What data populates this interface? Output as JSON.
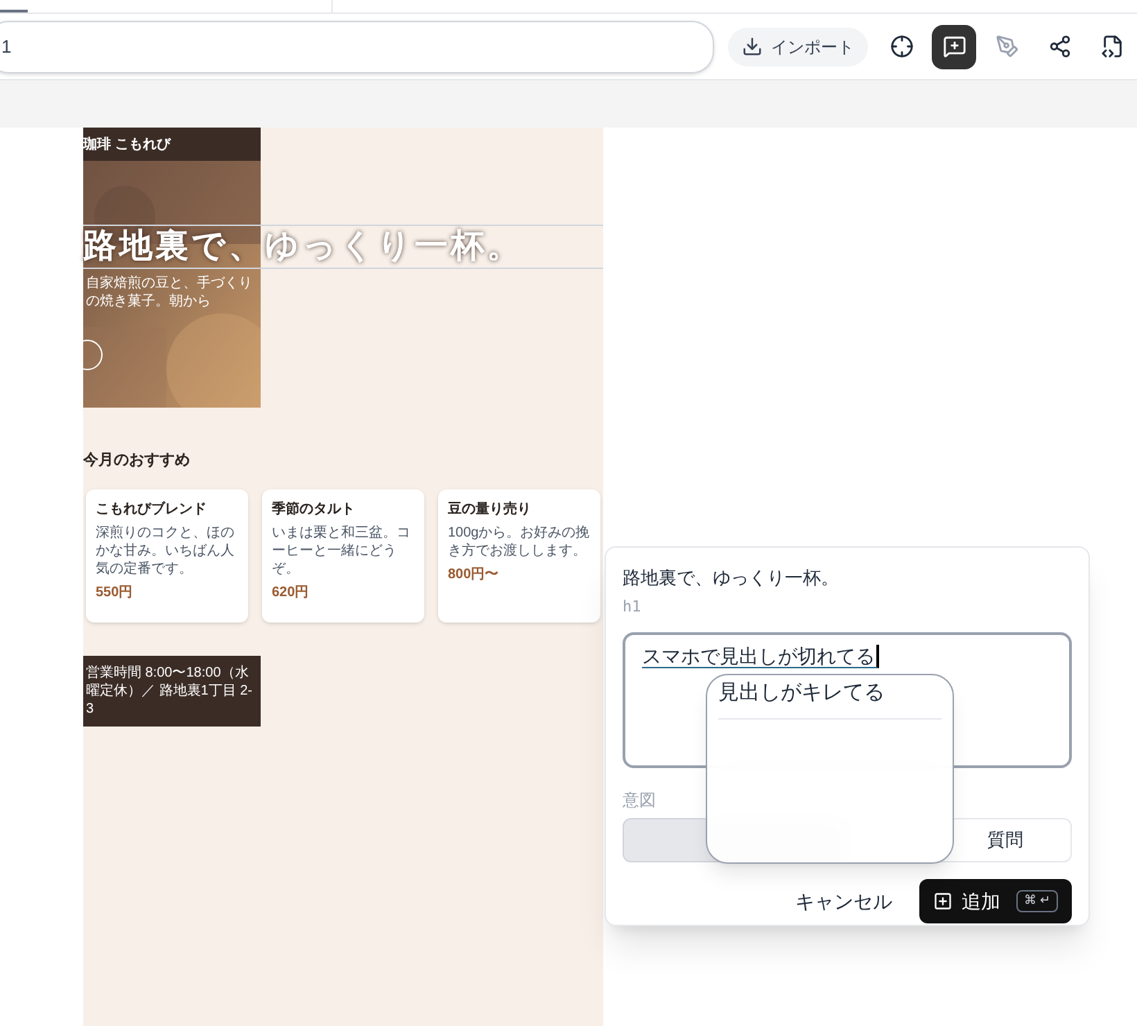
{
  "toolbar": {
    "address": "1",
    "import_label": "インポート",
    "tools": [
      {
        "kind": "target",
        "selected": false
      },
      {
        "kind": "comment",
        "selected": true
      },
      {
        "kind": "pen",
        "selected": false
      },
      {
        "kind": "share",
        "selected": false
      },
      {
        "kind": "code",
        "selected": false
      }
    ]
  },
  "preview": {
    "brand": "珈琲 こもれび",
    "hero_title": "路地裏で、ゆっくり一杯。",
    "hero_sub": "自家焙煎の豆と、手づくりの焼き菓子。朝から",
    "section_title": "今月のおすすめ",
    "cards": [
      {
        "name": "こもれびブレンド",
        "desc": "深煎りのコクと、ほのかな甘み。いちばん人気の定番です。",
        "price": "550円"
      },
      {
        "name": "季節のタルト",
        "desc": "いまは栗と和三盆。コーヒーと一緒にどうぞ。",
        "price": "620円"
      },
      {
        "name": "豆の量り売り",
        "desc": "100gから。お好みの挽き方でお渡しします。",
        "price": "800円〜"
      }
    ],
    "footer": "営業時間 8:00〜18:00（水曜定休）／ 路地裏1丁目 2-3"
  },
  "comment": {
    "target_text": "路地裏で、ゆっくり一杯。",
    "target_tag": "h1",
    "value": "スマホで見出しが切れてる",
    "suggestion": "見出しがキレてる",
    "intent_label": "意図",
    "intents": [
      {
        "selected": true
      },
      {
        "label": "質問",
        "selected": false
      }
    ],
    "cancel": "キャンセル",
    "add": "追加",
    "shortcut": "⌘ ↵"
  }
}
